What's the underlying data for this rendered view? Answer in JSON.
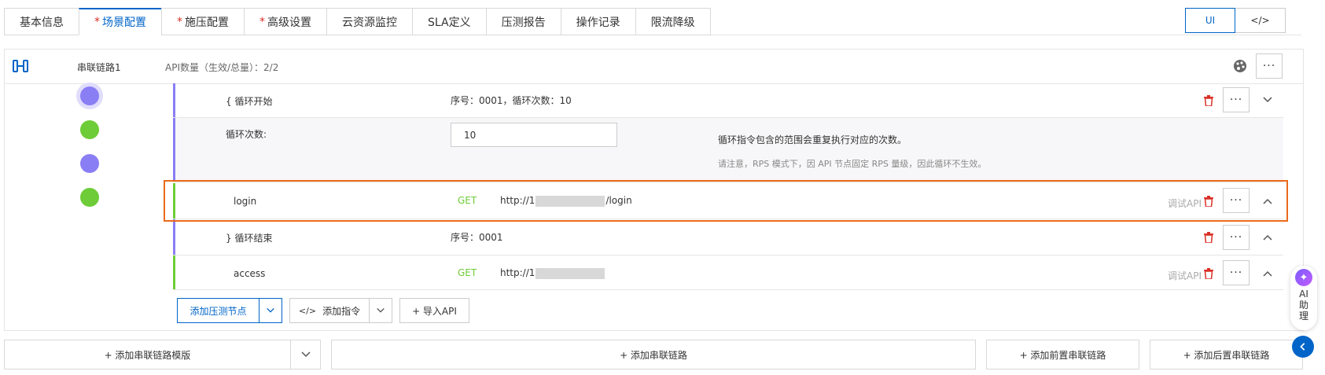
{
  "tabs": [
    {
      "label": "基本信息",
      "required": false,
      "active": false
    },
    {
      "label": "场景配置",
      "required": true,
      "active": true
    },
    {
      "label": "施压配置",
      "required": true,
      "active": false
    },
    {
      "label": "高级设置",
      "required": true,
      "active": false
    },
    {
      "label": "云资源监控",
      "required": false,
      "active": false
    },
    {
      "label": "SLA定义",
      "required": false,
      "active": false
    },
    {
      "label": "压测报告",
      "required": false,
      "active": false
    },
    {
      "label": "操作记录",
      "required": false,
      "active": false
    },
    {
      "label": "限流降级",
      "required": false,
      "active": false
    }
  ],
  "required_mark": "*",
  "mode": {
    "ui_label": "UI",
    "code_label": "</>"
  },
  "link": {
    "title": "串联链路1",
    "api_count": "API数量（生效/总量）：2/2",
    "more_label": "···"
  },
  "nodes": {
    "loop_start": {
      "label": "{ 循环开始",
      "meta": "序号：0001，循环次数：10"
    },
    "loop_body": {
      "field_label": "循环次数:",
      "field_value": "10",
      "hint": "循环指令包含的范围会重复执行对应的次数。",
      "note": "请注意，RPS 模式下，因 API 节点固定 RPS 量级，因此循环不生效。"
    },
    "login": {
      "name": "login",
      "method": "GET",
      "url_prefix": "http://1",
      "url_suffix": "/login",
      "debug": "调试API"
    },
    "loop_end": {
      "label": "} 循环结束",
      "meta": "序号：0001"
    },
    "access": {
      "name": "access",
      "method": "GET",
      "url_prefix": "http://1",
      "url_suffix": "",
      "debug": "调试API"
    }
  },
  "actions": {
    "add_node": "添加压测节点",
    "add_command": "添加指令",
    "import_api": "+ 导入API"
  },
  "footer": {
    "add_template": "+ 添加串联链路模版",
    "add_link": "+ 添加串联链路",
    "add_pre_link": "+ 添加前置串联链路",
    "add_post_link": "+ 添加后置串联链路"
  },
  "assistant": {
    "label": "AI助理"
  },
  "colors": {
    "accent": "#0064c8",
    "danger": "#d93026",
    "get": "#6dcc37",
    "loop": "#8a7ef5",
    "highlight": "#ea6b1a"
  }
}
